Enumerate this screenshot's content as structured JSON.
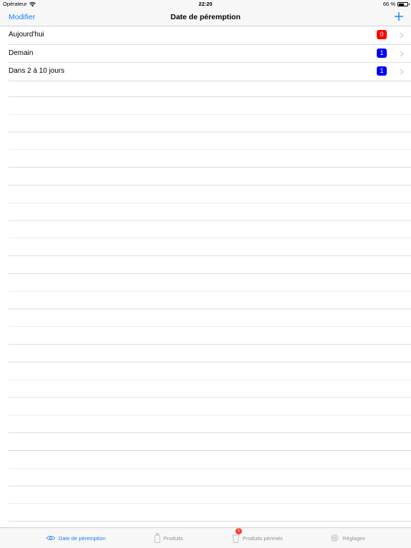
{
  "status_bar": {
    "carrier": "Opérateur",
    "time": "22:20",
    "battery_text": "66 %",
    "battery_level": 0.66
  },
  "nav": {
    "edit_label": "Modifier",
    "title": "Date de péremption",
    "add_icon": "plus-icon"
  },
  "rows": [
    {
      "label": "Aujourd'hui",
      "count": "0",
      "badge_color": "#ff0000"
    },
    {
      "label": "Demain",
      "count": "1",
      "badge_color": "#0000ff"
    },
    {
      "label": "Dans 2 à 10 jours",
      "count": "1",
      "badge_color": "#0000ff"
    }
  ],
  "tabs": [
    {
      "label": "Date de péremption",
      "icon": "eye-icon",
      "active": true
    },
    {
      "label": "Produits",
      "icon": "bottle-icon",
      "active": false
    },
    {
      "label": "Produits périmés",
      "icon": "trash-bottle-icon",
      "active": false,
      "badge": "1"
    },
    {
      "label": "Réglages",
      "icon": "gear-icon",
      "active": false
    }
  ],
  "colors": {
    "accent": "#147efb",
    "inactive": "#929292",
    "badge_red": "#ff0000",
    "badge_blue": "#0000ff"
  }
}
